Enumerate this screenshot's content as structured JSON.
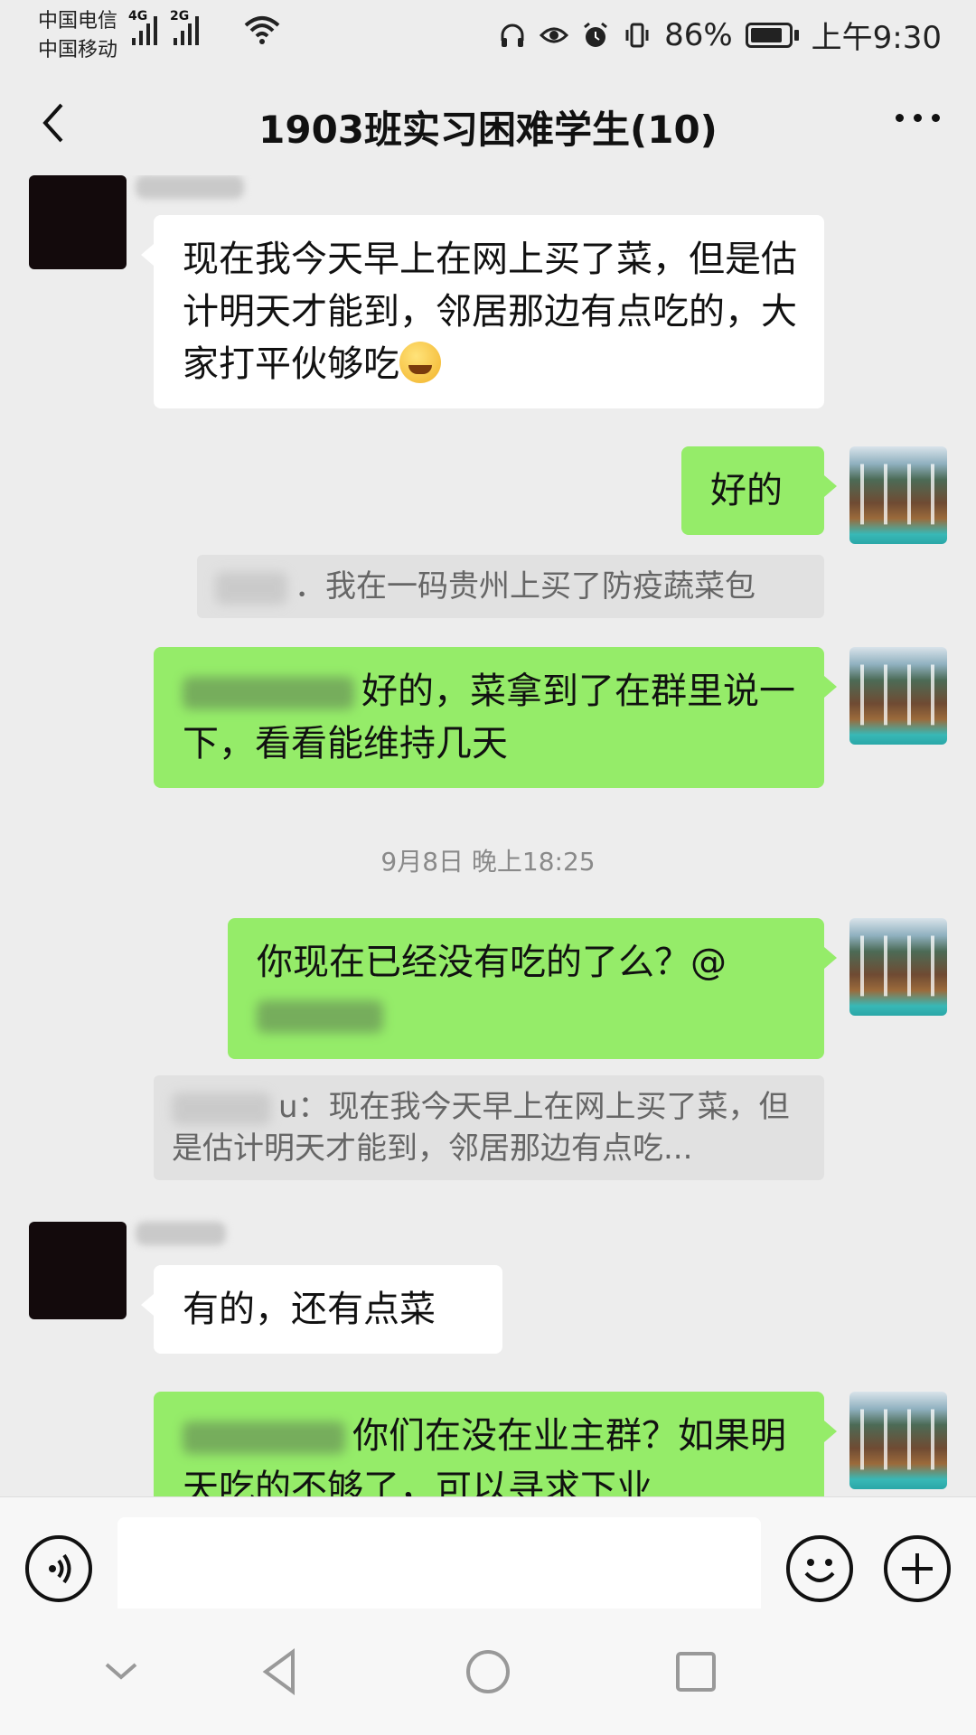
{
  "status": {
    "carrier_1": "中国电信",
    "carrier_2": "中国移动",
    "net_1": "4G",
    "net_2": "2G",
    "battery": "86%",
    "battery_level": 0.86,
    "time": "上午9:30"
  },
  "header": {
    "title": "1903班实习困难学生(10)",
    "back_icon": "chevron-left-icon",
    "more_icon": "more-dots-icon"
  },
  "messages": {
    "m1": {
      "text": "现在我今天早上在网上买了菜，但是估计明天才能到，邻居那边有点吃的，大家打平伙够吃"
    },
    "m2": {
      "text": "好的"
    },
    "m3_quote": {
      "text": "．我在一码贵州上买了防疫蔬菜包"
    },
    "m4": {
      "text": "好的，菜拿到了在群里说一下，看看能维持几天"
    },
    "timestamp": "9月8日 晚上18:25",
    "m5": {
      "text": "你现在已经没有吃的了么？@"
    },
    "m6_quote": {
      "text": "u：现在我今天早上在网上买了菜，但是估计明天才能到，邻居那边有点吃..."
    },
    "m7": {
      "text": "有的，还有点菜"
    },
    "m8": {
      "text": "你们在没在业主群？如果明天吃的不够了，可以寻求下业"
    }
  },
  "input": {
    "placeholder": "",
    "value": ""
  },
  "icons": {
    "voice": "voice-icon",
    "emoji": "smiley-icon",
    "plus": "plus-icon",
    "nav_down": "chevron-down-icon",
    "nav_back": "triangle-back-icon",
    "nav_home": "circle-home-icon",
    "nav_recent": "square-recent-icon"
  }
}
